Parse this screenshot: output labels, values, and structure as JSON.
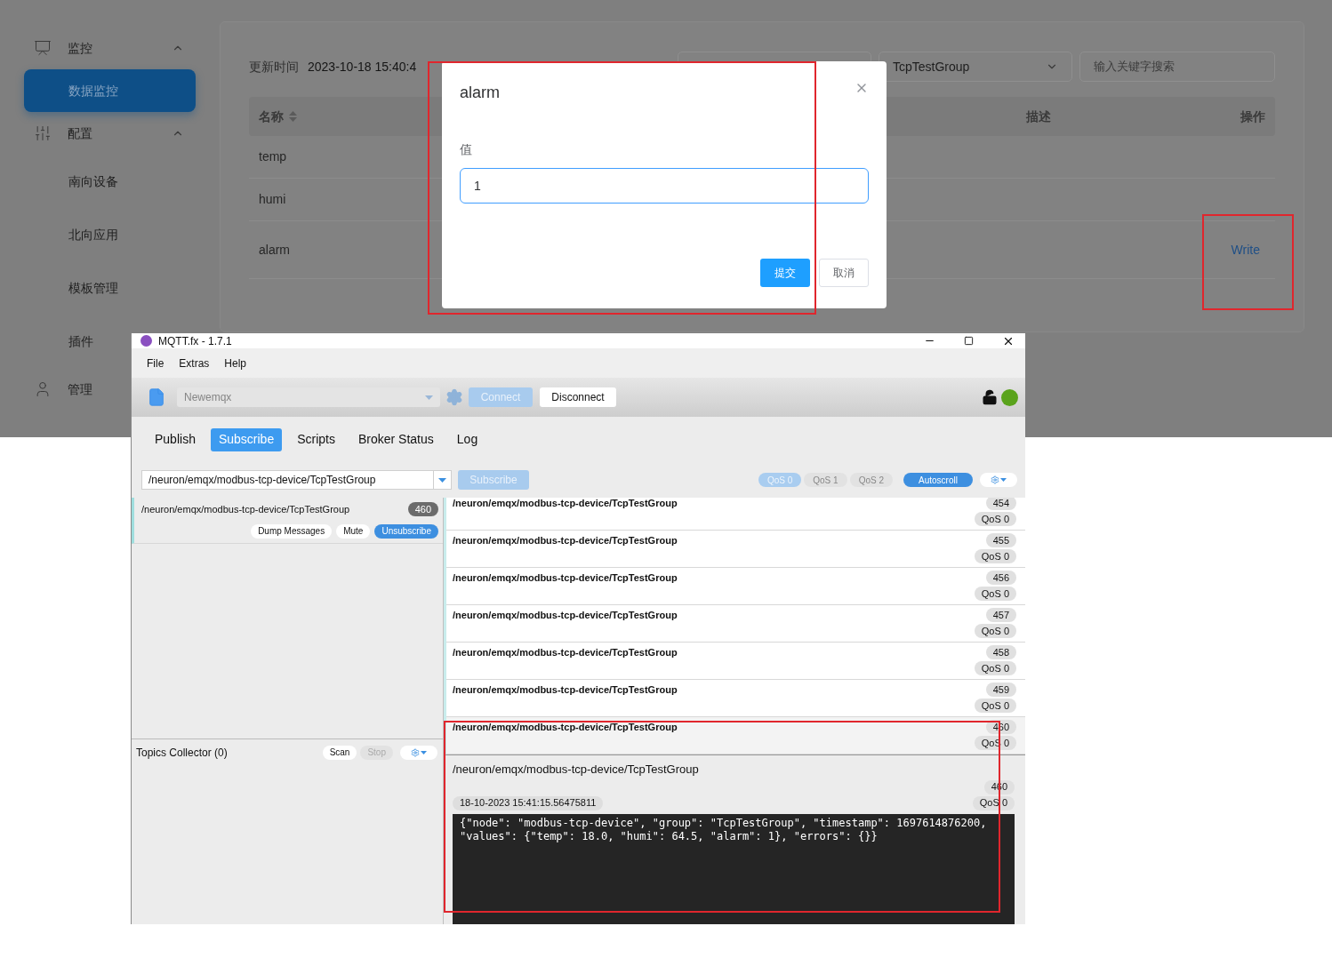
{
  "web_app": {
    "sidebar": {
      "items": [
        {
          "label": "监控",
          "expanded": true,
          "children": [
            {
              "label": "数据监控",
              "selected": true
            }
          ]
        },
        {
          "label": "配置",
          "expanded": true,
          "children": [
            {
              "label": "南向设备",
              "selected": false
            },
            {
              "label": "北向应用",
              "selected": false
            },
            {
              "label": "模板管理",
              "selected": false
            },
            {
              "label": "插件",
              "selected": false
            }
          ]
        },
        {
          "label": "管理"
        }
      ]
    },
    "content": {
      "update_label": "更新时间",
      "update_time": "2023-10-18 15:40:4",
      "group_select": {
        "value": "TcpTestGroup"
      },
      "search": {
        "placeholder": "输入关键字搜索"
      },
      "table": {
        "columns": [
          {
            "label": "名称",
            "sortable": true
          },
          {
            "label": "描述",
            "sortable": false
          },
          {
            "label": "操作",
            "sortable": false
          }
        ],
        "rows": [
          {
            "name": "temp"
          },
          {
            "name": "humi"
          },
          {
            "name": "alarm",
            "action": "Write"
          }
        ]
      }
    },
    "modal": {
      "title": "alarm",
      "field_label": "值",
      "value": "1",
      "focused": true,
      "buttons": [
        {
          "label": "提交",
          "kind": "primary"
        },
        {
          "label": "取消",
          "kind": "default"
        }
      ]
    }
  },
  "mqtt_window": {
    "title": "MQTT.fx - 1.7.1",
    "menu": [
      "File",
      "Extras",
      "Help"
    ],
    "toolbar": {
      "profile": "Newemqx",
      "connect": {
        "label": "Connect",
        "disabled": true
      },
      "disconnect": {
        "label": "Disconnect",
        "disabled": false
      },
      "connected": true
    },
    "tabs": [
      {
        "label": "Publish",
        "selected": false
      },
      {
        "label": "Subscribe",
        "selected": true
      },
      {
        "label": "Scripts",
        "selected": false
      },
      {
        "label": "Broker Status",
        "selected": false
      },
      {
        "label": "Log",
        "selected": false
      }
    ],
    "subscribe_bar": {
      "topic": "/neuron/emqx/modbus-tcp-device/TcpTestGroup",
      "button": {
        "label": "Subscribe",
        "disabled": true
      },
      "qos": [
        {
          "label": "QoS 0",
          "selected": true
        },
        {
          "label": "QoS 1",
          "selected": false
        },
        {
          "label": "QoS 2",
          "selected": false
        }
      ],
      "autoscroll": {
        "label": "Autoscroll",
        "on": true
      }
    },
    "subscriptions": [
      {
        "topic": "/neuron/emqx/modbus-tcp-device/TcpTestGroup",
        "count": "460",
        "buttons": [
          {
            "label": "Dump Messages",
            "kind": "default"
          },
          {
            "label": "Mute",
            "kind": "default"
          },
          {
            "label": "Unsubscribe",
            "kind": "primary"
          }
        ]
      }
    ],
    "topics_collector": {
      "title": "Topics Collector (0)",
      "buttons": [
        {
          "label": "Scan",
          "disabled": false
        },
        {
          "label": "Stop",
          "disabled": true
        }
      ]
    },
    "messages": [
      {
        "topic": "/neuron/emqx/modbus-tcp-device/TcpTestGroup",
        "number": "454",
        "qos": "QoS 0",
        "selected": false
      },
      {
        "topic": "/neuron/emqx/modbus-tcp-device/TcpTestGroup",
        "number": "455",
        "qos": "QoS 0",
        "selected": false
      },
      {
        "topic": "/neuron/emqx/modbus-tcp-device/TcpTestGroup",
        "number": "456",
        "qos": "QoS 0",
        "selected": false
      },
      {
        "topic": "/neuron/emqx/modbus-tcp-device/TcpTestGroup",
        "number": "457",
        "qos": "QoS 0",
        "selected": false
      },
      {
        "topic": "/neuron/emqx/modbus-tcp-device/TcpTestGroup",
        "number": "458",
        "qos": "QoS 0",
        "selected": false
      },
      {
        "topic": "/neuron/emqx/modbus-tcp-device/TcpTestGroup",
        "number": "459",
        "qos": "QoS 0",
        "selected": false
      },
      {
        "topic": "/neuron/emqx/modbus-tcp-device/TcpTestGroup",
        "number": "460",
        "qos": "QoS 0",
        "selected": true
      }
    ],
    "detail": {
      "topic": "/neuron/emqx/modbus-tcp-device/TcpTestGroup",
      "number": "460",
      "timestamp": "18-10-2023  15:41:15.56475811",
      "qos": "QoS 0",
      "payload_lines": [
        "{\"node\": \"modbus-tcp-device\", \"group\": \"TcpTestGroup\", \"timestamp\": 1697614876200,",
        "\"values\": {\"temp\": 18.0, \"humi\": 64.5, \"alarm\": 1}, \"errors\": {}}"
      ]
    }
  }
}
